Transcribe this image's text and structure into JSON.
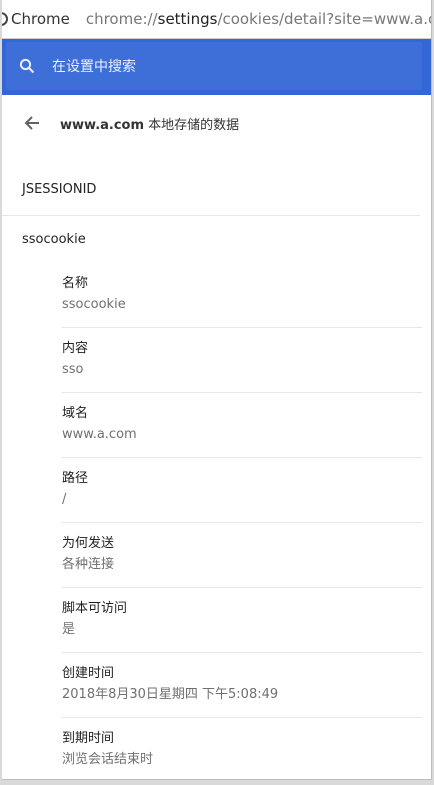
{
  "address_bar": {
    "browser": "Chrome",
    "url_prefix": "chrome://",
    "url_host": "settings",
    "url_rest": "/cookies/detail?site=www.a.com"
  },
  "search": {
    "placeholder": "在设置中搜索"
  },
  "header": {
    "site": "www.a.com",
    "title_suffix": " 本地存储的数据"
  },
  "cookies": [
    "JSESSIONID",
    "ssocookie"
  ],
  "details": [
    {
      "label": "名称",
      "value": "ssocookie"
    },
    {
      "label": "内容",
      "value": "sso"
    },
    {
      "label": "域名",
      "value": "www.a.com"
    },
    {
      "label": "路径",
      "value": "/"
    },
    {
      "label": "为何发送",
      "value": "各种连接"
    },
    {
      "label": "脚本可访问",
      "value": "是"
    },
    {
      "label": "创建时间",
      "value": "2018年8月30日星期四 下午5:08:49"
    },
    {
      "label": "到期时间",
      "value": "浏览会话结束时"
    }
  ],
  "colors": {
    "header_blue": "#3367d6",
    "text": "#222222",
    "muted": "#707070"
  },
  "icons": {
    "site_info": "site-info-icon",
    "search": "search-icon",
    "back": "back-arrow-icon"
  }
}
